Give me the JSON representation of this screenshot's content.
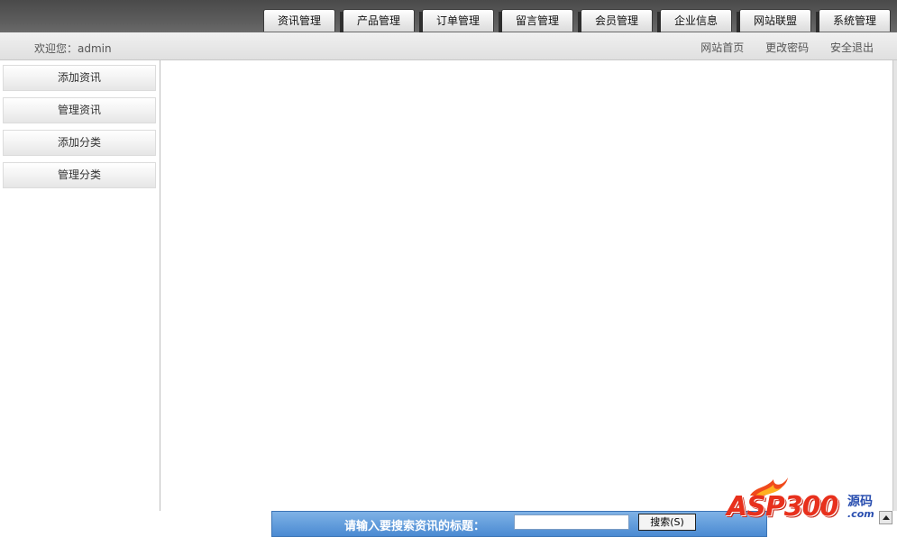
{
  "nav_tabs": [
    {
      "label": "资讯管理"
    },
    {
      "label": "产品管理"
    },
    {
      "label": "订单管理"
    },
    {
      "label": "留言管理"
    },
    {
      "label": "会员管理"
    },
    {
      "label": "企业信息"
    },
    {
      "label": "网站联盟"
    },
    {
      "label": "系统管理"
    }
  ],
  "header": {
    "welcome": "欢迎您：admin",
    "links": {
      "home": "网站首页",
      "password": "更改密码",
      "logout": "安全退出"
    }
  },
  "sidebar": {
    "items": [
      {
        "label": "添加资讯"
      },
      {
        "label": "管理资讯"
      },
      {
        "label": "添加分类"
      },
      {
        "label": "管理分类"
      }
    ]
  },
  "search": {
    "label": "请输入要搜索资讯的标题：",
    "value": "",
    "button": "搜索(S)"
  },
  "watermark": {
    "brand": "ASP300",
    "cn": "源码",
    "domain": ".com"
  }
}
